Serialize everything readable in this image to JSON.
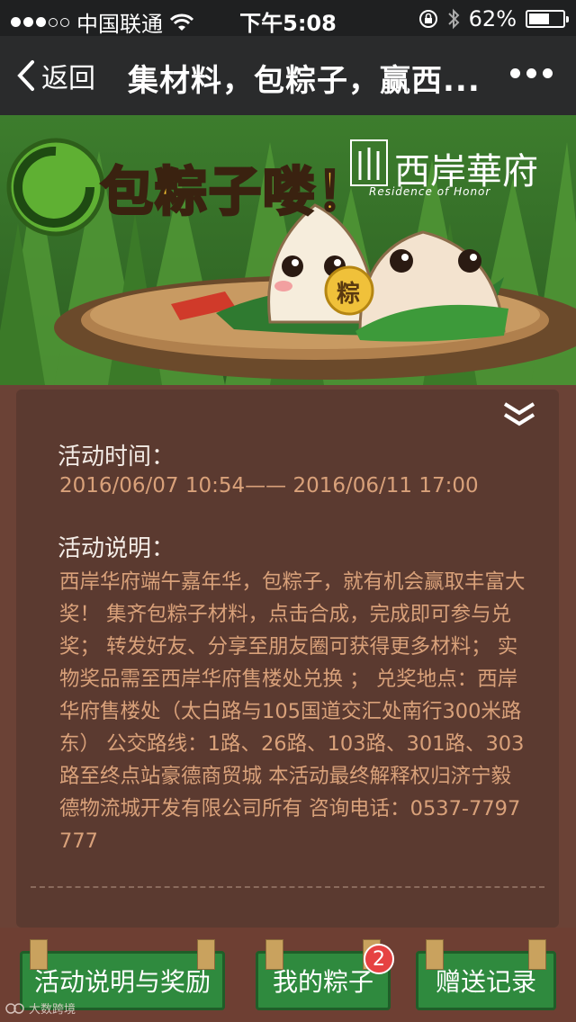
{
  "status": {
    "carrier": "中国联通",
    "time": "下午5:08",
    "battery": "62%",
    "battery_level": 0.62
  },
  "nav": {
    "back_label": "返回",
    "title": "集材料，包粽子，赢西...",
    "more_icon": "more-dots-icon"
  },
  "banner": {
    "headline": "包粽子喽！",
    "brand": "西岸華府",
    "brand_sub": "Residence of Honor",
    "coin_text": "粽"
  },
  "activity": {
    "time_label": "活动时间：",
    "time_value": "2016/06/07 10:54—— 2016/06/11 17:00",
    "desc_label": "活动说明：",
    "desc_text": "西岸华府端午嘉年华，包粽子，就有机会赢取丰富大奖！ 集齐包粽子材料，点击合成，完成即可参与兑奖； 转发好友、分享至朋友圈可获得更多材料； 实物奖品需至西岸华府售楼处兑换 ； 兑奖地点：西岸华府售楼处（太白路与105国道交汇处南行300米路东） 公交路线：1路、26路、103路、301路、303路至终点站豪德商贸城 本活动最终解释权归济宁毅德物流城开发有限公司所有 咨询电话：0537-7797777"
  },
  "bottom": {
    "btn1": "活动说明与奖励",
    "btn2": "我的粽子",
    "btn2_badge": "2",
    "btn3": "赠送记录"
  },
  "watermark": "大数跨境",
  "colors": {
    "accent_green": "#2f8a3e",
    "panel_bg": "#5b3a30",
    "orange_text": "#d9a17a",
    "badge_red": "#e64242"
  }
}
